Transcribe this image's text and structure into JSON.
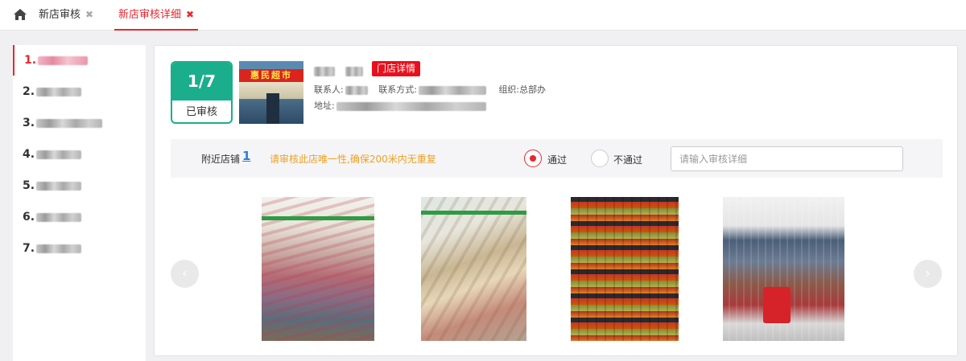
{
  "tabs": [
    {
      "label": "新店审核",
      "active": false
    },
    {
      "label": "新店审核详细",
      "active": true
    }
  ],
  "sidebar": {
    "items": [
      {
        "label": "1.",
        "active": true
      },
      {
        "label": "2.",
        "active": false
      },
      {
        "label": "3.",
        "active": false
      },
      {
        "label": "4.",
        "active": false
      },
      {
        "label": "5.",
        "active": false
      },
      {
        "label": "6.",
        "active": false
      },
      {
        "label": "7.",
        "active": false
      }
    ]
  },
  "store": {
    "counter": "1/7",
    "status": "已审核",
    "photo_sign": "惠民超市",
    "detail_badge": "门店详情",
    "contact_label": "联系人:",
    "phone_label": "联系方式:",
    "org_label": "组织:",
    "org_value": "总部办",
    "address_label": "地址:"
  },
  "review": {
    "nearby_label": "附近店铺",
    "nearby_count": "1",
    "tip": "请审核此店唯一性,确保200米内无重复",
    "pass_label": "通过",
    "fail_label": "不通过",
    "selected": "pass",
    "detail_placeholder": "请输入审核详细"
  },
  "colors": {
    "accent": "#e8272e",
    "counter": "#1bae8c",
    "tip": "#f0a020",
    "link": "#2b7fd6"
  },
  "icons": {
    "home": "home-icon",
    "close": "close-icon",
    "prev": "chevron-left-icon",
    "next": "chevron-right-icon"
  }
}
